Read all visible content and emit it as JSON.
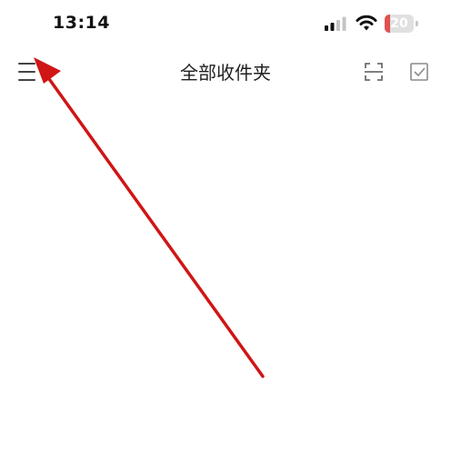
{
  "status_bar": {
    "time": "13:14",
    "battery_level": "20",
    "battery_fraction": 0.2,
    "icons": [
      "signal-icon",
      "wifi-icon",
      "battery-icon"
    ]
  },
  "nav_bar": {
    "title": "全部收件夹",
    "icons": [
      "menu-icon",
      "scan-icon",
      "multi-select-icon"
    ]
  },
  "colors": {
    "annotation_arrow": "#d01515",
    "battery_low": "#e05151",
    "icon_gray": "#6e6e6e",
    "text": "#1f1f1f"
  }
}
